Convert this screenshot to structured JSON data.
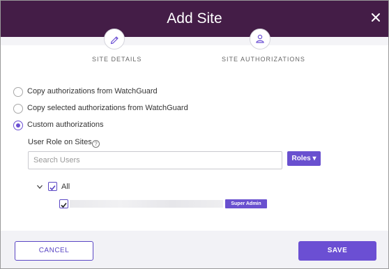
{
  "dialog": {
    "title": "Add Site",
    "close_icon": "close-icon"
  },
  "steps": [
    {
      "label": "SITE DETAILS",
      "icon": "pencil-icon"
    },
    {
      "label": "SITE AUTHORIZATIONS",
      "icon": "user-key-icon"
    }
  ],
  "options": [
    {
      "label": "Copy authorizations from WatchGuard",
      "selected": false
    },
    {
      "label": "Copy selected authorizations from WatchGuard",
      "selected": false
    },
    {
      "label": "Custom authorizations",
      "selected": true
    }
  ],
  "roles_section": {
    "label": "User Role on Sites",
    "help_icon": "help-icon",
    "search_placeholder": "Search Users",
    "search_value": "",
    "roles_button": "Roles ▾"
  },
  "tree": {
    "all_label": "All",
    "all_checked": true,
    "users": [
      {
        "name": "",
        "checked": true,
        "role": "Super Admin"
      }
    ]
  },
  "footer": {
    "cancel_label": "CANCEL",
    "save_label": "SAVE"
  },
  "colors": {
    "header": "#441d47",
    "accent": "#6b4fd3"
  }
}
